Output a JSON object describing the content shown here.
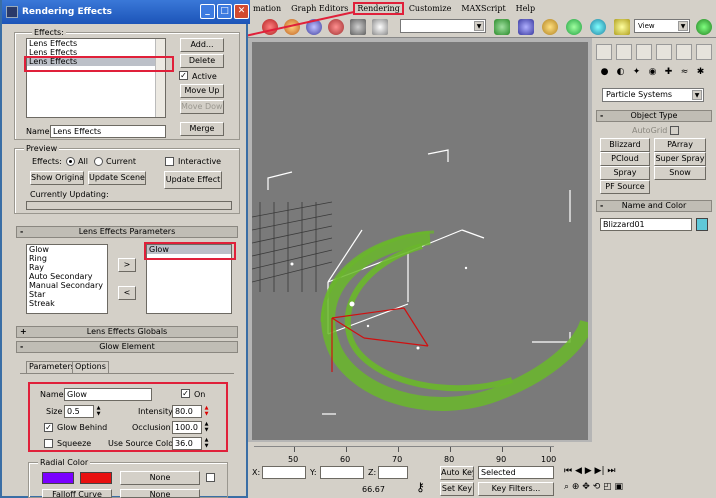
{
  "menubar": {
    "items": [
      "mation",
      "Graph Editors",
      "Rendering",
      "Customize",
      "MAXScript",
      "Help"
    ]
  },
  "toolbar": {
    "select_filter": "",
    "view_drop": "View"
  },
  "command_panel": {
    "category_dropdown": "Particle Systems",
    "object_type_title": "Object Type",
    "autogrid_label": "AutoGrid",
    "object_buttons": [
      "Blizzard",
      "PArray",
      "PCloud",
      "Super Spray",
      "Spray",
      "Snow",
      "PF Source"
    ],
    "name_color_title": "Name and Color",
    "object_name": "Blizzard01",
    "object_color": "#5fc8d8"
  },
  "timeline": {
    "ticks": [
      "50",
      "60",
      "70",
      "80",
      "90",
      "100"
    ]
  },
  "status": {
    "x_label": "X:",
    "y_label": "Y:",
    "z_label": "Z:",
    "frame_value": "66.67",
    "auto_key": "Auto Key",
    "set_key": "Set Key",
    "key_mode": "Selected",
    "key_filters": "Key Filters..."
  },
  "dialog": {
    "title": "Rendering Effects",
    "effects_label": "Effects:",
    "effects_list": [
      "Lens Effects",
      "Lens Effects",
      "Lens Effects"
    ],
    "selected_effect_index": 2,
    "buttons": {
      "add": "Add...",
      "delete": "Delete",
      "move_up": "Move Up",
      "move_down": "Move Down",
      "merge": "Merge"
    },
    "active_label": "Active",
    "name_label": "Name:",
    "name_value": "Lens Effects",
    "preview": {
      "title": "Preview",
      "effects_label": "Effects:",
      "all_label": "All",
      "current_label": "Current",
      "interactive_label": "Interactive",
      "show_original": "Show Original",
      "update_scene": "Update Scene",
      "update_effect": "Update Effect",
      "currently_updating": "Currently Updating:"
    },
    "lens_params": {
      "title": "Lens Effects Parameters",
      "available": [
        "Glow",
        "Ring",
        "Ray",
        "Auto Secondary",
        "Manual Secondary",
        "Star",
        "Streak"
      ],
      "selected": [
        "Glow"
      ],
      "add_arrow": ">",
      "remove_arrow": "<"
    },
    "globals_title": "Lens Effects Globals",
    "glow_title": "Glow Element",
    "glow_tabs": [
      "Parameters",
      "Options"
    ],
    "glow": {
      "name_label": "Name:",
      "name_value": "Glow",
      "on_label": "On",
      "size_label": "Size",
      "size_value": "0.5",
      "intensity_label": "Intensity",
      "intensity_value": "80.0",
      "glow_behind_label": "Glow Behind",
      "occlusion_label": "Occlusion",
      "occlusion_value": "100.0",
      "squeeze_label": "Squeeze",
      "use_source_label": "Use Source Color",
      "use_source_value": "36.0"
    },
    "radial": {
      "title": "Radial Color",
      "color1": "#7a00ff",
      "color2": "#e81010",
      "none_label": "None",
      "falloff_label": "Falloff Curve",
      "none2_label": "None"
    }
  },
  "colors": {
    "highlight": "#e0203a",
    "particles": "#6ab82a",
    "viewport_bg": "#7a7a7a"
  }
}
